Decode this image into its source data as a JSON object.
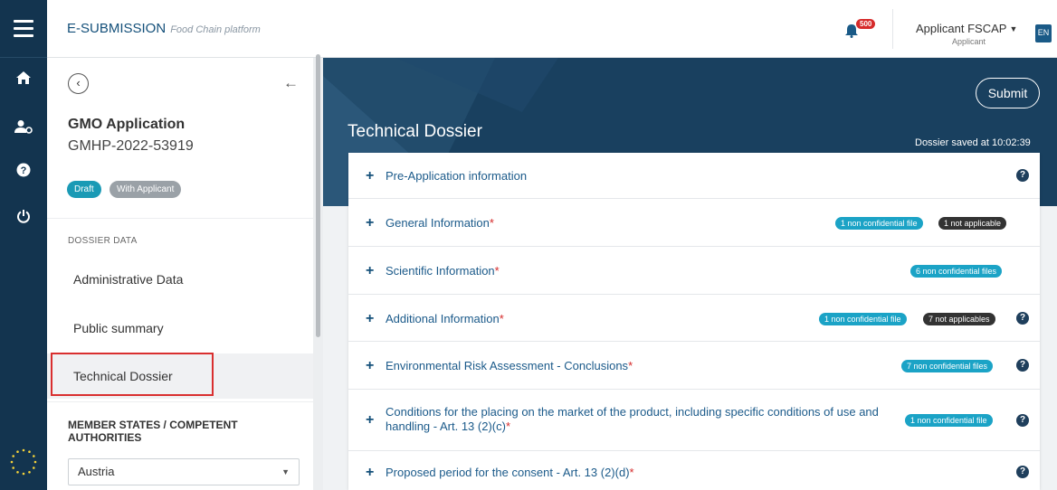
{
  "topbar": {
    "brand": "E-SUBMISSION",
    "brand_sub": "Food Chain platform",
    "notifications_count": "500",
    "user_name": "Applicant FSCAP",
    "user_role": "Applicant",
    "language": "EN"
  },
  "rail": {
    "icons": [
      "menu-icon",
      "home-icon",
      "user-settings-icon",
      "help-icon",
      "power-icon",
      "eu-flag-icon"
    ]
  },
  "sidebar": {
    "app_title": "GMO Application",
    "app_id": "GMHP-2022-53919",
    "status_draft": "Draft",
    "status_with": "With Applicant",
    "section_label": "DOSSIER DATA",
    "nav": [
      "Administrative Data",
      "Public summary",
      "Technical Dossier"
    ],
    "active_nav": "Technical Dossier",
    "member_states_title": "MEMBER STATES / COMPETENT AUTHORITIES",
    "country": "Austria"
  },
  "main": {
    "title": "Technical Dossier",
    "submit_label": "Submit",
    "saved_text": "Dossier saved at 10:02:39",
    "rows": [
      {
        "label": "Pre-Application information",
        "required": false,
        "badges": [],
        "help": true
      },
      {
        "label": "General Information",
        "required": true,
        "badges": [
          "1 non confidential file",
          "1 not applicable"
        ],
        "help": false
      },
      {
        "label": "Scientific Information",
        "required": true,
        "badges": [
          "6 non confidential files"
        ],
        "help": false
      },
      {
        "label": "Additional Information",
        "required": true,
        "badges": [
          "1 non confidential file",
          "7 not applicables"
        ],
        "help": true
      },
      {
        "label": "Environmental Risk Assessment - Conclusions",
        "required": true,
        "badges": [
          "7 non confidential files"
        ],
        "help": true
      },
      {
        "label_line1": "Conditions for the placing on the market of the product, including specific conditions of use and",
        "label_line2": "handling - Art. 13 (2)(c)",
        "required": true,
        "badges": [
          "1 non confidential file"
        ],
        "help": true
      },
      {
        "label": "Proposed period for the consent - Art. 13 (2)(d)",
        "required": true,
        "badges": [],
        "help": true
      }
    ],
    "help_glyph": "?",
    "required_mark": "*",
    "plus_glyph": "+"
  },
  "colors": {
    "rail": "#13344f",
    "band": "#19405f",
    "link": "#1b5a8a",
    "teal_badge": "#1ba3c6",
    "dark_badge": "#333333",
    "required": "#d62b2b",
    "highlight_border": "#d92f2f"
  }
}
